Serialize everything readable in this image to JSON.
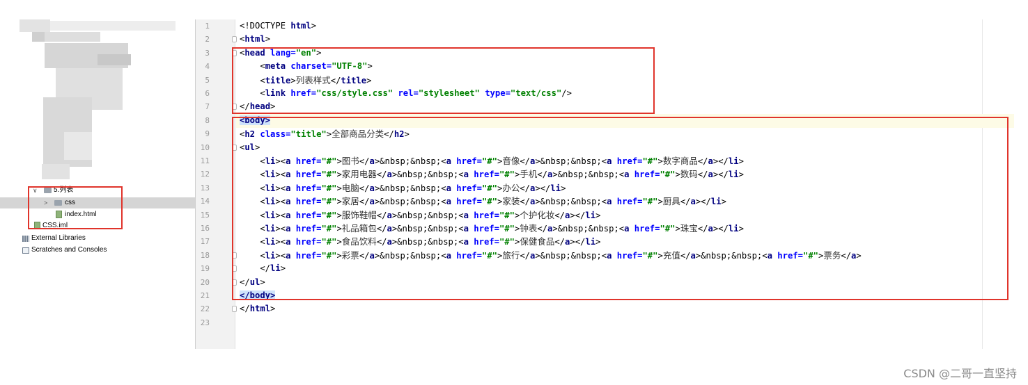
{
  "project_tree": {
    "items": [
      {
        "label": "5.列表",
        "kind": "folder",
        "expanded": true
      },
      {
        "label": "css",
        "kind": "folder",
        "expanded": false
      },
      {
        "label": "index.html",
        "kind": "file"
      },
      {
        "label": "CSS.iml",
        "kind": "file"
      },
      {
        "label": "External Libraries",
        "kind": "libraries"
      },
      {
        "label": "Scratches and Consoles",
        "kind": "scratches"
      }
    ]
  },
  "editor": {
    "line_numbers": [
      "1",
      "2",
      "3",
      "4",
      "5",
      "6",
      "7",
      "8",
      "9",
      "10",
      "11",
      "12",
      "13",
      "14",
      "15",
      "16",
      "17",
      "18",
      "19",
      "20",
      "21",
      "22",
      "23"
    ],
    "lines": [
      [
        [
          "p",
          "<!DOCTYPE "
        ],
        [
          "t",
          "html"
        ],
        [
          "p",
          ">"
        ]
      ],
      [
        [
          "p",
          "<"
        ],
        [
          "t",
          "html"
        ],
        [
          "p",
          ">"
        ]
      ],
      [
        [
          "p",
          "<"
        ],
        [
          "t",
          "head "
        ],
        [
          "a",
          "lang="
        ],
        [
          "v",
          "\"en\""
        ],
        [
          "p",
          ">"
        ]
      ],
      [
        [
          "p",
          "    <"
        ],
        [
          "t",
          "meta "
        ],
        [
          "a",
          "charset="
        ],
        [
          "v",
          "\"UTF-8\""
        ],
        [
          "p",
          ">"
        ]
      ],
      [
        [
          "p",
          "    <"
        ],
        [
          "t",
          "title"
        ],
        [
          "p",
          ">"
        ],
        [
          "c",
          "列表样式"
        ],
        [
          "p",
          "</"
        ],
        [
          "t",
          "title"
        ],
        [
          "p",
          ">"
        ]
      ],
      [
        [
          "p",
          "    <"
        ],
        [
          "t",
          "link "
        ],
        [
          "a",
          "href="
        ],
        [
          "v",
          "\"css/style.css\" "
        ],
        [
          "a",
          "rel="
        ],
        [
          "v",
          "\"stylesheet\" "
        ],
        [
          "a",
          "type="
        ],
        [
          "v",
          "\"text/css\""
        ],
        [
          "p",
          "/>"
        ]
      ],
      [
        [
          "p",
          "</"
        ],
        [
          "t",
          "head"
        ],
        [
          "p",
          ">"
        ]
      ],
      [
        [
          "s",
          "<body>"
        ]
      ],
      [
        [
          "p",
          "<"
        ],
        [
          "t",
          "h2 "
        ],
        [
          "a",
          "class="
        ],
        [
          "v",
          "\"title\""
        ],
        [
          "p",
          ">"
        ],
        [
          "c",
          "全部商品分类"
        ],
        [
          "p",
          "</"
        ],
        [
          "t",
          "h2"
        ],
        [
          "p",
          ">"
        ]
      ],
      [
        [
          "p",
          "<"
        ],
        [
          "t",
          "ul"
        ],
        [
          "p",
          ">"
        ]
      ],
      [
        [
          "p",
          "    <"
        ],
        [
          "t",
          "li"
        ],
        [
          "p",
          "><"
        ],
        [
          "t",
          "a "
        ],
        [
          "a",
          "href="
        ],
        [
          "v",
          "\"#\""
        ],
        [
          "p",
          ">"
        ],
        [
          "c",
          "图书"
        ],
        [
          "p",
          "</"
        ],
        [
          "t",
          "a"
        ],
        [
          "p",
          ">&nbsp;&nbsp;<"
        ],
        [
          "t",
          "a "
        ],
        [
          "a",
          "href="
        ],
        [
          "v",
          "\"#\""
        ],
        [
          "p",
          ">"
        ],
        [
          "c",
          "音像"
        ],
        [
          "p",
          "</"
        ],
        [
          "t",
          "a"
        ],
        [
          "p",
          ">&nbsp;&nbsp;<"
        ],
        [
          "t",
          "a "
        ],
        [
          "a",
          "href="
        ],
        [
          "v",
          "\"#\""
        ],
        [
          "p",
          ">"
        ],
        [
          "c",
          "数字商品"
        ],
        [
          "p",
          "</"
        ],
        [
          "t",
          "a"
        ],
        [
          "p",
          "></"
        ],
        [
          "t",
          "li"
        ],
        [
          "p",
          ">"
        ]
      ],
      [
        [
          "p",
          "    <"
        ],
        [
          "t",
          "li"
        ],
        [
          "p",
          "><"
        ],
        [
          "t",
          "a "
        ],
        [
          "a",
          "href="
        ],
        [
          "v",
          "\"#\""
        ],
        [
          "p",
          ">"
        ],
        [
          "c",
          "家用电器"
        ],
        [
          "p",
          "</"
        ],
        [
          "t",
          "a"
        ],
        [
          "p",
          ">&nbsp;&nbsp;<"
        ],
        [
          "t",
          "a "
        ],
        [
          "a",
          "href="
        ],
        [
          "v",
          "\"#\""
        ],
        [
          "p",
          ">"
        ],
        [
          "c",
          "手机"
        ],
        [
          "p",
          "</"
        ],
        [
          "t",
          "a"
        ],
        [
          "p",
          ">&nbsp;&nbsp;<"
        ],
        [
          "t",
          "a "
        ],
        [
          "a",
          "href="
        ],
        [
          "v",
          "\"#\""
        ],
        [
          "p",
          ">"
        ],
        [
          "c",
          "数码"
        ],
        [
          "p",
          "</"
        ],
        [
          "t",
          "a"
        ],
        [
          "p",
          "></"
        ],
        [
          "t",
          "li"
        ],
        [
          "p",
          ">"
        ]
      ],
      [
        [
          "p",
          "    <"
        ],
        [
          "t",
          "li"
        ],
        [
          "p",
          "><"
        ],
        [
          "t",
          "a "
        ],
        [
          "a",
          "href="
        ],
        [
          "v",
          "\"#\""
        ],
        [
          "p",
          ">"
        ],
        [
          "c",
          "电脑"
        ],
        [
          "p",
          "</"
        ],
        [
          "t",
          "a"
        ],
        [
          "p",
          ">&nbsp;&nbsp;<"
        ],
        [
          "t",
          "a "
        ],
        [
          "a",
          "href="
        ],
        [
          "v",
          "\"#\""
        ],
        [
          "p",
          ">"
        ],
        [
          "c",
          "办公"
        ],
        [
          "p",
          "</"
        ],
        [
          "t",
          "a"
        ],
        [
          "p",
          "></"
        ],
        [
          "t",
          "li"
        ],
        [
          "p",
          ">"
        ]
      ],
      [
        [
          "p",
          "    <"
        ],
        [
          "t",
          "li"
        ],
        [
          "p",
          "><"
        ],
        [
          "t",
          "a "
        ],
        [
          "a",
          "href="
        ],
        [
          "v",
          "\"#\""
        ],
        [
          "p",
          ">"
        ],
        [
          "c",
          "家居"
        ],
        [
          "p",
          "</"
        ],
        [
          "t",
          "a"
        ],
        [
          "p",
          ">&nbsp;&nbsp;<"
        ],
        [
          "t",
          "a "
        ],
        [
          "a",
          "href="
        ],
        [
          "v",
          "\"#\""
        ],
        [
          "p",
          ">"
        ],
        [
          "c",
          "家装"
        ],
        [
          "p",
          "</"
        ],
        [
          "t",
          "a"
        ],
        [
          "p",
          ">&nbsp;&nbsp;<"
        ],
        [
          "t",
          "a "
        ],
        [
          "a",
          "href="
        ],
        [
          "v",
          "\"#\""
        ],
        [
          "p",
          ">"
        ],
        [
          "c",
          "厨具"
        ],
        [
          "p",
          "</"
        ],
        [
          "t",
          "a"
        ],
        [
          "p",
          "></"
        ],
        [
          "t",
          "li"
        ],
        [
          "p",
          ">"
        ]
      ],
      [
        [
          "p",
          "    <"
        ],
        [
          "t",
          "li"
        ],
        [
          "p",
          "><"
        ],
        [
          "t",
          "a "
        ],
        [
          "a",
          "href="
        ],
        [
          "v",
          "\"#\""
        ],
        [
          "p",
          ">"
        ],
        [
          "c",
          "服饰鞋帽"
        ],
        [
          "p",
          "</"
        ],
        [
          "t",
          "a"
        ],
        [
          "p",
          ">&nbsp;&nbsp;<"
        ],
        [
          "t",
          "a "
        ],
        [
          "a",
          "href="
        ],
        [
          "v",
          "\"#\""
        ],
        [
          "p",
          ">"
        ],
        [
          "c",
          "个护化妆"
        ],
        [
          "p",
          "</"
        ],
        [
          "t",
          "a"
        ],
        [
          "p",
          "></"
        ],
        [
          "t",
          "li"
        ],
        [
          "p",
          ">"
        ]
      ],
      [
        [
          "p",
          "    <"
        ],
        [
          "t",
          "li"
        ],
        [
          "p",
          "><"
        ],
        [
          "t",
          "a "
        ],
        [
          "a",
          "href="
        ],
        [
          "v",
          "\"#\""
        ],
        [
          "p",
          ">"
        ],
        [
          "c",
          "礼品箱包"
        ],
        [
          "p",
          "</"
        ],
        [
          "t",
          "a"
        ],
        [
          "p",
          ">&nbsp;&nbsp;<"
        ],
        [
          "t",
          "a "
        ],
        [
          "a",
          "href="
        ],
        [
          "v",
          "\"#\""
        ],
        [
          "p",
          ">"
        ],
        [
          "c",
          "钟表"
        ],
        [
          "p",
          "</"
        ],
        [
          "t",
          "a"
        ],
        [
          "p",
          ">&nbsp;&nbsp;<"
        ],
        [
          "t",
          "a "
        ],
        [
          "a",
          "href="
        ],
        [
          "v",
          "\"#\""
        ],
        [
          "p",
          ">"
        ],
        [
          "c",
          "珠宝"
        ],
        [
          "p",
          "</"
        ],
        [
          "t",
          "a"
        ],
        [
          "p",
          "></"
        ],
        [
          "t",
          "li"
        ],
        [
          "p",
          ">"
        ]
      ],
      [
        [
          "p",
          "    <"
        ],
        [
          "t",
          "li"
        ],
        [
          "p",
          "><"
        ],
        [
          "t",
          "a "
        ],
        [
          "a",
          "href="
        ],
        [
          "v",
          "\"#\""
        ],
        [
          "p",
          ">"
        ],
        [
          "c",
          "食品饮料"
        ],
        [
          "p",
          "</"
        ],
        [
          "t",
          "a"
        ],
        [
          "p",
          ">&nbsp;&nbsp;<"
        ],
        [
          "t",
          "a "
        ],
        [
          "a",
          "href="
        ],
        [
          "v",
          "\"#\""
        ],
        [
          "p",
          ">"
        ],
        [
          "c",
          "保健食品"
        ],
        [
          "p",
          "</"
        ],
        [
          "t",
          "a"
        ],
        [
          "p",
          "></"
        ],
        [
          "t",
          "li"
        ],
        [
          "p",
          ">"
        ]
      ],
      [
        [
          "p",
          "    <"
        ],
        [
          "t",
          "li"
        ],
        [
          "p",
          "><"
        ],
        [
          "t",
          "a "
        ],
        [
          "a",
          "href="
        ],
        [
          "v",
          "\"#\""
        ],
        [
          "p",
          ">"
        ],
        [
          "c",
          "彩票"
        ],
        [
          "p",
          "</"
        ],
        [
          "t",
          "a"
        ],
        [
          "p",
          ">&nbsp;&nbsp;<"
        ],
        [
          "t",
          "a "
        ],
        [
          "a",
          "href="
        ],
        [
          "v",
          "\"#\""
        ],
        [
          "p",
          ">"
        ],
        [
          "c",
          "旅行"
        ],
        [
          "p",
          "</"
        ],
        [
          "t",
          "a"
        ],
        [
          "p",
          ">&nbsp;&nbsp;<"
        ],
        [
          "t",
          "a "
        ],
        [
          "a",
          "href="
        ],
        [
          "v",
          "\"#\""
        ],
        [
          "p",
          ">"
        ],
        [
          "c",
          "充值"
        ],
        [
          "p",
          "</"
        ],
        [
          "t",
          "a"
        ],
        [
          "p",
          ">&nbsp;&nbsp;<"
        ],
        [
          "t",
          "a "
        ],
        [
          "a",
          "href="
        ],
        [
          "v",
          "\"#\""
        ],
        [
          "p",
          ">"
        ],
        [
          "c",
          "票务"
        ],
        [
          "p",
          "</"
        ],
        [
          "t",
          "a"
        ],
        [
          "p",
          ">"
        ]
      ],
      [
        [
          "p",
          "    </"
        ],
        [
          "t",
          "li"
        ],
        [
          "p",
          ">"
        ]
      ],
      [
        [
          "p",
          "</"
        ],
        [
          "t",
          "ul"
        ],
        [
          "p",
          ">"
        ]
      ],
      [
        [
          "s",
          "</body>"
        ]
      ],
      [
        [
          "p",
          "</"
        ],
        [
          "t",
          "html"
        ],
        [
          "p",
          ">"
        ]
      ],
      []
    ]
  },
  "watermark": "CSDN @二哥一直坚持"
}
